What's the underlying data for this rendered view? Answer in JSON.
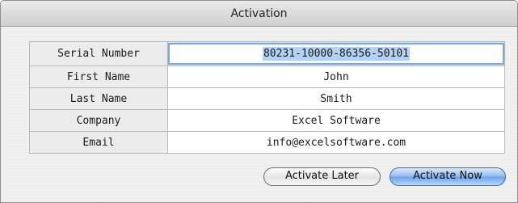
{
  "window": {
    "title": "Activation"
  },
  "form": {
    "rows": [
      {
        "label": "Serial Number",
        "value": "80231-10000-86356-50101"
      },
      {
        "label": "First Name",
        "value": "John"
      },
      {
        "label": "Last Name",
        "value": "Smith"
      },
      {
        "label": "Company",
        "value": "Excel Software"
      },
      {
        "label": "Email",
        "value": "info@excelsoftware.com"
      }
    ]
  },
  "buttons": {
    "activate_later": "Activate Later",
    "activate_now": "Activate Now"
  },
  "colors": {
    "focus_ring": "#7fa7dc",
    "selection": "#b4d2f4",
    "default_button": "#6aa3ec"
  }
}
